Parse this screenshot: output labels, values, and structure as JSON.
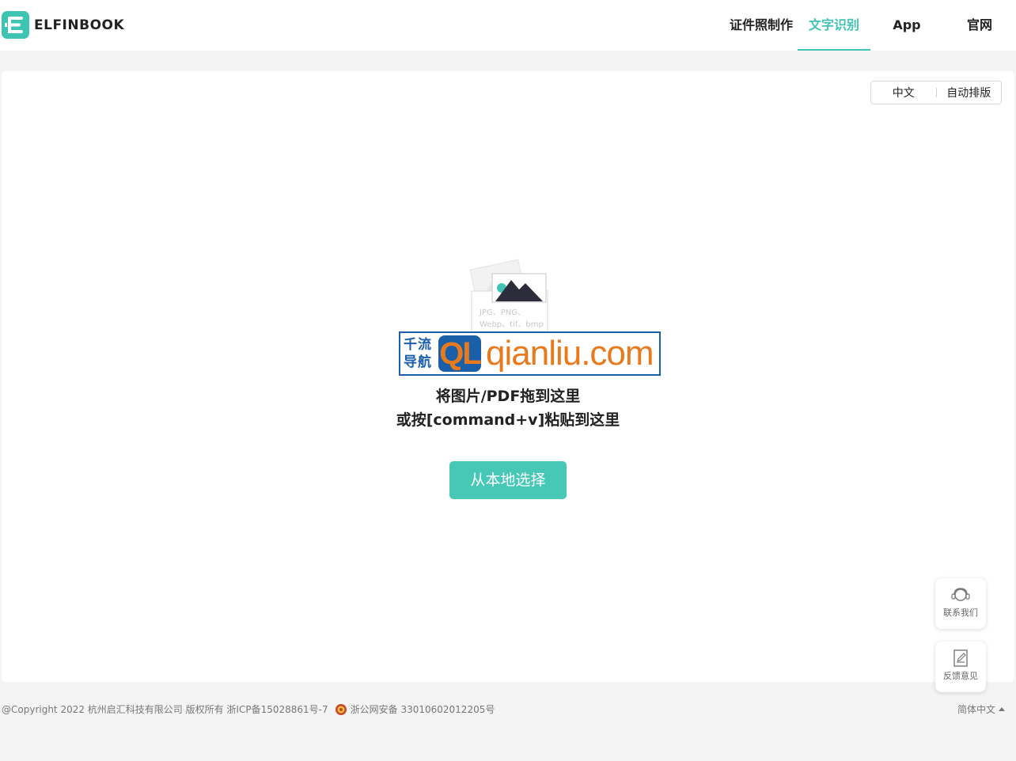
{
  "header": {
    "logo_text": "ELFINBOOK",
    "nav": [
      {
        "label": "证件照制作",
        "active": false
      },
      {
        "label": "文字识别",
        "active": true
      },
      {
        "label": "App",
        "active": false
      },
      {
        "label": "官网",
        "active": false
      }
    ]
  },
  "options": {
    "language": "中文",
    "layout": "自动排版"
  },
  "upload": {
    "formats_line1": "JPG、PNG、",
    "formats_line2": "Webp、tif、bmp",
    "drop_line1": "将图片/PDF拖到这里",
    "drop_line2": "或按[command+v]粘贴到这里",
    "select_button": "从本地选择"
  },
  "watermark": {
    "cn_line1": "千流",
    "cn_line2": "导航",
    "mark": "QL",
    "url": "qianliu.com"
  },
  "float": {
    "contact": "联系我们",
    "feedback": "反馈意见"
  },
  "footer": {
    "copyright": "@Copyright 2022 杭州启汇科技有限公司 版权所有 浙ICP备15028861号-7",
    "police": "浙公网安备 33010602012205号",
    "language": "简体中文"
  },
  "colors": {
    "accent": "#3fc4b3",
    "button": "#47c7b6",
    "watermark_blue": "#1a5fa8",
    "watermark_orange": "#e87a1e"
  }
}
